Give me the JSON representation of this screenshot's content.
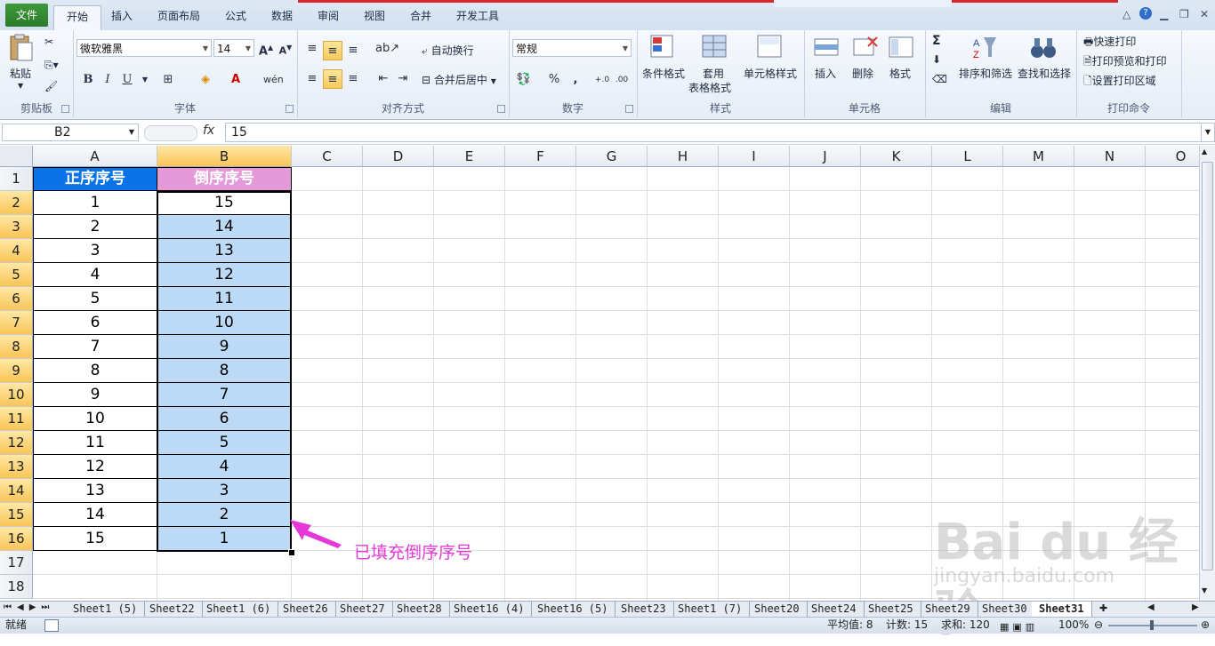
{
  "ribbon_tabs": [
    "文件",
    "开始",
    "插入",
    "页面布局",
    "公式",
    "数据",
    "审阅",
    "视图",
    "合并",
    "开发工具"
  ],
  "clipboard": {
    "paste": "粘贴",
    "group": "剪贴板"
  },
  "font": {
    "name": "微软雅黑",
    "size": "14",
    "group": "字体",
    "bold": "B",
    "italic": "I",
    "underline": "U"
  },
  "alignment": {
    "wrap": "自动换行",
    "merge": "合并后居中",
    "group": "对齐方式"
  },
  "number": {
    "format": "常规",
    "percent": "%",
    "comma": ",",
    "group": "数字"
  },
  "styles": {
    "conditional": "条件格式",
    "table_a": "套用",
    "table_b": "表格格式",
    "cell_styles": "单元格样式",
    "group": "样式"
  },
  "cells": {
    "insert": "插入",
    "delete": "删除",
    "format": "格式",
    "group": "单元格"
  },
  "editing": {
    "sum": "Σ",
    "sort": "排序和筛选",
    "find": "查找和选择",
    "group": "编辑"
  },
  "print": {
    "quick": "快速打印",
    "preview": "打印预览和打印",
    "area": "设置打印区域",
    "group": "打印命令"
  },
  "formula_bar": {
    "name_box": "B2",
    "fx": "fx",
    "value": "15"
  },
  "columns": [
    "A",
    "B",
    "C",
    "D",
    "E",
    "F",
    "G",
    "H",
    "I",
    "J",
    "K",
    "L",
    "M",
    "N",
    "O"
  ],
  "rows": [
    "1",
    "2",
    "3",
    "4",
    "5",
    "6",
    "7",
    "8",
    "9",
    "10",
    "11",
    "12",
    "13",
    "14",
    "15",
    "16",
    "17",
    "18"
  ],
  "header_a": "正序序号",
  "header_b": "倒序序号",
  "col_a_values": [
    "1",
    "2",
    "3",
    "4",
    "5",
    "6",
    "7",
    "8",
    "9",
    "10",
    "11",
    "12",
    "13",
    "14",
    "15"
  ],
  "col_b_values": [
    "15",
    "14",
    "13",
    "12",
    "11",
    "10",
    "9",
    "8",
    "7",
    "6",
    "5",
    "4",
    "3",
    "2",
    "1"
  ],
  "annotation": "已填充倒序序号",
  "sheet_tabs": [
    "Sheet1 (5)",
    "Sheet22",
    "Sheet1 (6)",
    "Sheet26",
    "Sheet27",
    "Sheet28",
    "Sheet16 (4)",
    "Sheet16 (5)",
    "Sheet23",
    "Sheet1 (7)",
    "Sheet20",
    "Sheet24",
    "Sheet25",
    "Sheet29",
    "Sheet30",
    "Sheet31"
  ],
  "status": {
    "ready": "就绪",
    "average": "平均值: 8",
    "count": "计数: 15",
    "sum": "求和: 120",
    "zoom": "100%"
  },
  "watermark": {
    "main": "Bai du 经验",
    "sub": "jingyan.baidu.com"
  },
  "colors": {
    "header_a_bg": "#0a73e8",
    "header_b_bg": "#e49ad8",
    "selection_fill": "#bcd9f5",
    "annotation": "#e638d6"
  }
}
